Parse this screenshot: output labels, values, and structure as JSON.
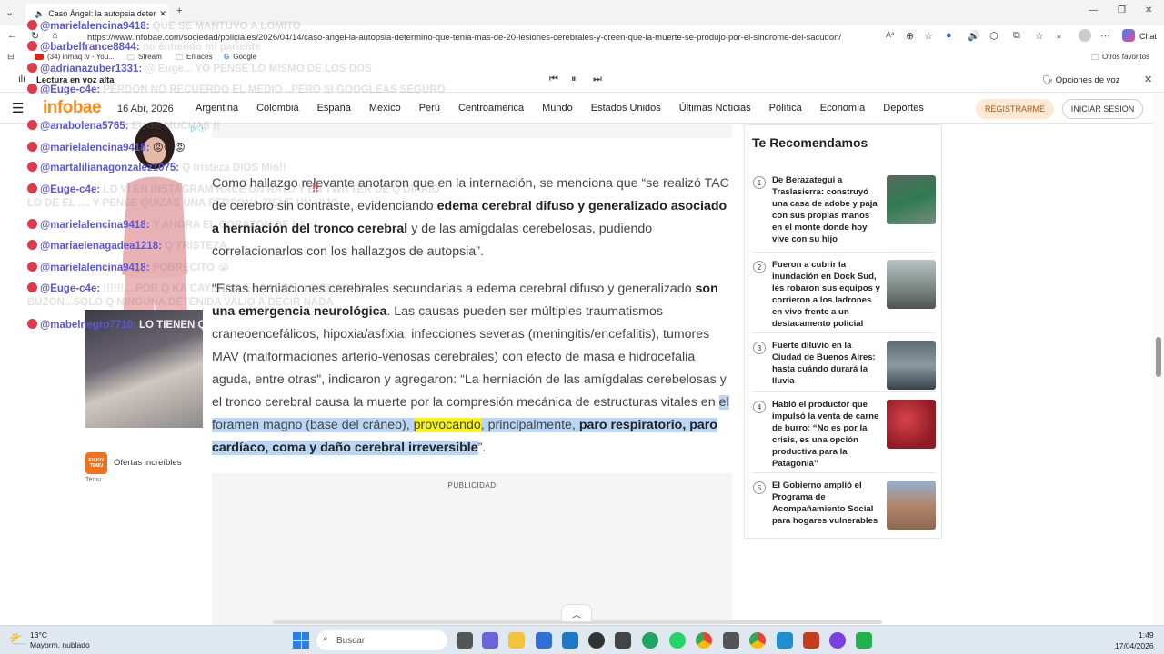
{
  "browser": {
    "tab_title": "Caso Ángel: la autopsia deter",
    "url": "https://www.infobae.com/sociedad/policiales/2026/04/14/caso-angel-la-autopsia-determino-que-tenia-mas-de-20-lesiones-cerebrales-y-creen-que-la-muerte-se-produjo-por-el-sindrome-del-sacudon/",
    "chat_label": "Chat",
    "favorites": [
      "(34) inmaq tv - You...",
      "Stream",
      "Enlaces",
      "Google"
    ],
    "other_favorites": "Otros favoritos",
    "read_aloud": "Lectura en voz alta",
    "voice_options": "Opciones de voz"
  },
  "site": {
    "logo": "infobae",
    "date": "16 Abr, 2026",
    "nav": [
      "Argentina",
      "Colombia",
      "España",
      "México",
      "Perú",
      "Centroamérica",
      "Mundo",
      "Estados Unidos",
      "Últimas Noticias",
      "Política",
      "Economía",
      "Deportes"
    ],
    "register": "REGISTRARME",
    "login": "INICIAR SESION"
  },
  "article": {
    "p1_a": "Como hallazgo relevante anotaron que en la internación, se menciona que “se realizó TAC de cerebro sin contraste, evidenciando ",
    "p1_b": "edema cerebral difuso y generalizado asociado a herniación del tronco cerebral",
    "p1_c": " y de las amígdalas cerebelosas, pudiendo correlacionarlos con los hallazgos de autopsia”.",
    "p2_a": "“Estas herniaciones cerebrales secundarias a edema cerebral difuso y generalizado ",
    "p2_b": "son una emergencia neurológica",
    "p2_c": ". Las causas pueden ser múltiples traumatismos craneoencefálicos, hipoxia/asfixia, infecciones severas (meningitis/encefalitis), tumores MAV (malformaciones arterio-venosas cerebrales) con efecto de masa e hidrocefalia aguda, entre otras\", indicaron y agregaron: “La herniación de las amígdalas cerebelosas y el tronco cerebral causa la muerte por la compresión mecánica de estructuras vitales en ",
    "p2_d": "el foramen magno (base del cráneo), ",
    "p2_e": "provocando",
    "p2_f": ", principalmente, ",
    "p2_g": "paro respiratorio, paro cardíaco, coma y daño cerebral irreversible",
    "p2_h": "”.",
    "ad_label": "PUBLICIDAD"
  },
  "recommend": {
    "title": "Te Recomendamos",
    "items": [
      {
        "n": "1",
        "text": "De Berazategui a Traslasierra: construyó una casa de adobe y paja con sus propias manos en el monte donde hoy vive con su hijo"
      },
      {
        "n": "2",
        "text": "Fueron a cubrir la inundación en Dock Sud, les robaron sus equipos y corrieron a los ladrones en vivo frente a un destacamento policial"
      },
      {
        "n": "3",
        "text": "Fuerte diluvio en la Ciudad de Buenos Aires: hasta cuándo durará la lluvia"
      },
      {
        "n": "4",
        "text": "Habló el productor que impulsó la venta de carne de burro: “No es por la crisis, es una opción productiva para la Patagonia”"
      },
      {
        "n": "5",
        "text": "El Gobierno amplió el Programa de Acompañamiento Social para hogares vulnerables"
      }
    ]
  },
  "chat": [
    {
      "user": "@marielalencina9418:",
      "msg": "QUE SE MANTUVO A LOMITO"
    },
    {
      "user": "@barbelfrance8844:",
      "msg": "no entiendo mi pariente"
    },
    {
      "user": "@adrianazuber1331:",
      "msg": "@ Euge... YO PENSE LO MISMO DE LOS DOS"
    },
    {
      "user": "@Euge-c4e:",
      "msg": "PERDON NO RECUERDO EL MEDIO ..PERO SI GOOGLEAS SEGURO"
    },
    {
      "user": "@anabolena5765:",
      "msg": "EUGE MUCHAS !!"
    },
    {
      "user": "@marielalencina9418:",
      "msg": "😡😡😡"
    },
    {
      "user": "@martalilianagonzalez1075:",
      "msg": "Q tristeza DIOS Mío!!"
    },
    {
      "user": "@Euge-c4e:",
      "msg": "LO VI EN INSTAGRAM HACE UN RATO Y EN TWITTER DE Q DIARIO LO DE EL .... Y PENSE QUIZAS UNA PERSONA TIENE UN HIJO"
    },
    {
      "user": "@marielalencina9418:",
      "msg": "Y AHORA EL CORAZON DE LA"
    },
    {
      "user": "@mariaelenagadea1218:",
      "msg": "Q TRISTEZA"
    },
    {
      "user": "@marielalencina9418:",
      "msg": "POBRECITO 😭"
    },
    {
      "user": "@Euge-c4e:",
      "msg": "!!!!!!....POR Q KA CAYENDO EL PADRE ... Y EL SIN Q BUZON...SOLO Q NINGUNA DETENIDA VALIO A DECIR NADA"
    },
    {
      "user": "@mabelnegro7710:",
      "msg": "LO TIENEN Q CUIDAR QUE PAGUE EN VIDA, QUE SE"
    }
  ],
  "ads": {
    "temu_label": "Ofertas increíbles",
    "temu_brand": "Temu",
    "temu_logo": "ENJOY TEMU"
  },
  "taskbar": {
    "temp": "13°C",
    "weather": "Mayorm. nublado",
    "search": "Buscar",
    "time": "1:49",
    "date": "17/04/2026"
  },
  "colors": {
    "brand": "#f68b1f",
    "highlight_blue": "#b8d6f3",
    "highlight_yellow": "#f6f21a",
    "chat_user": "#5b58d8"
  }
}
